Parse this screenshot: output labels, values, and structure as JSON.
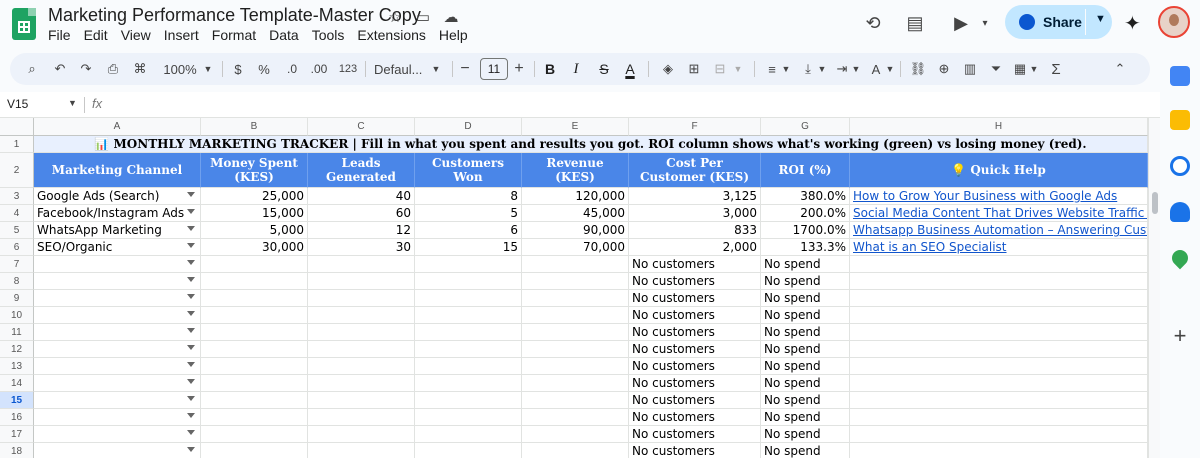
{
  "app": {
    "doc_title": "Marketing Performance Template-Master Copy",
    "menu": [
      "File",
      "Edit",
      "View",
      "Insert",
      "Format",
      "Data",
      "Tools",
      "Extensions",
      "Help"
    ],
    "share_label": "Share"
  },
  "toolbar": {
    "zoom": "100%",
    "currency": "$",
    "percent": "%",
    "dec_decrease": ".0",
    "dec_increase": ".00",
    "number_format": "123",
    "font": "Defaul...",
    "font_size": "11",
    "bold": "B",
    "font_color": "A"
  },
  "formula_bar": {
    "name_box": "V15",
    "fx": "fx"
  },
  "columns": [
    "A",
    "B",
    "C",
    "D",
    "E",
    "F",
    "G",
    "H"
  ],
  "banner": "📊 MONTHLY MARKETING TRACKER | Fill in what you spent and results you got. ROI column shows what's working (green) vs losing money (red).",
  "headers": [
    "Marketing Channel",
    "Money Spent (KES)",
    "Leads Generated",
    "Customers Won",
    "Revenue (KES)",
    "Cost Per Customer (KES)",
    "ROI (%)",
    "💡 Quick Help"
  ],
  "data_rows": [
    {
      "channel": "Google Ads (Search)",
      "spent": "25,000",
      "leads": "40",
      "customers": "8",
      "revenue": "120,000",
      "cpc": "3,125",
      "roi": "380.0%",
      "help": "How to Grow Your Business with Google Ads"
    },
    {
      "channel": "Facebook/Instagram Ads",
      "spent": "15,000",
      "leads": "60",
      "customers": "5",
      "revenue": "45,000",
      "cpc": "3,000",
      "roi": "200.0%",
      "help": "Social Media Content That Drives Website Traffic in Kenya"
    },
    {
      "channel": "WhatsApp Marketing",
      "spent": "5,000",
      "leads": "12",
      "customers": "6",
      "revenue": "90,000",
      "cpc": "833",
      "roi": "1700.0%",
      "help": "Whatsapp Business Automation – Answering Customer Questions"
    },
    {
      "channel": "SEO/Organic",
      "spent": "30,000",
      "leads": "30",
      "customers": "15",
      "revenue": "70,000",
      "cpc": "2,000",
      "roi": "133.3%",
      "help": "What is an SEO Specialist"
    }
  ],
  "empty_row_numbers": [
    "7",
    "8",
    "9",
    "10",
    "11",
    "12",
    "13",
    "14",
    "15",
    "16",
    "17",
    "18"
  ],
  "empty_cpc": "No customers",
  "empty_roi": "No spend",
  "colors": {
    "header_blue": "#4a86e8",
    "banner_bg": "#e8f0fe",
    "link": "#1155cc",
    "share_bg": "#c2e7ff"
  }
}
